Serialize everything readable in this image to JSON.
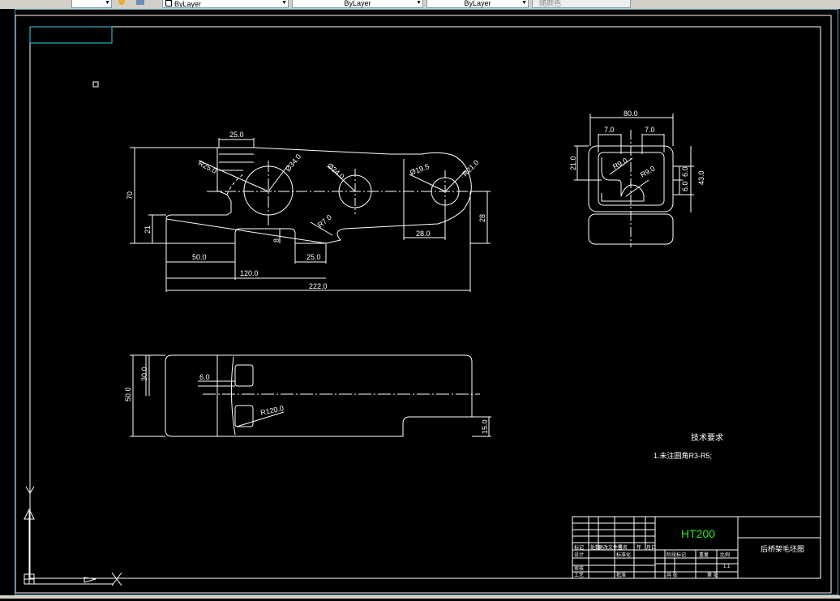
{
  "toolbar": {
    "linetype_value": "ByLayer",
    "lineweight_value": "ByLayer",
    "linecolor_value": "ByLayer",
    "plotstyle_value": "随颜色"
  },
  "dimensions": {
    "top_view": {
      "d25_top": "25.0",
      "r25": "R25.0",
      "d34": "Ø34.0",
      "d24": "Ø24.0",
      "d19": "Ø19.5",
      "r21": "R21.0",
      "r7": "R7.0",
      "h70": "70",
      "h21": "21",
      "h8": "8",
      "h28": "28",
      "w28": "28.0",
      "w50": "50.0",
      "w25": "25.0",
      "w120": "120.0",
      "w222": "222.0"
    },
    "side_view": {
      "w80": "80.0",
      "w7a": "7.0",
      "w7b": "7.0",
      "h21": "21.0",
      "r9a": "R9.0",
      "r9b": "R9.0",
      "h6a": "6.0",
      "h6b": "6.0",
      "h43": "43.0"
    },
    "front_view": {
      "h30": "30.0",
      "h50": "50.0",
      "w6": "6.0",
      "r120": "R120.0",
      "h15": "15.0"
    }
  },
  "notes": {
    "title": "技术要求",
    "item1": "1.未注圆角R3-R5;"
  },
  "title_block": {
    "material": "HT200",
    "part_name": "后桥架毛坯图",
    "scale_label": "比例",
    "ratio": "1:1"
  }
}
